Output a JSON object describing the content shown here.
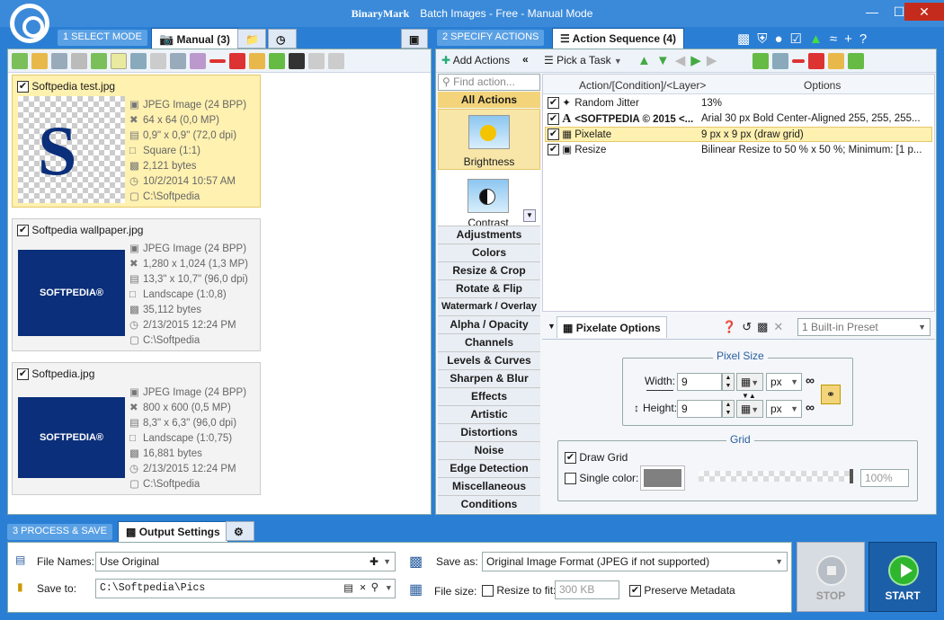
{
  "window": {
    "brand": "BinaryMark",
    "title": "Batch Images - Free - Manual Mode",
    "controls": [
      "—",
      "☐",
      "✕"
    ]
  },
  "modes": {
    "select_label": "1 SELECT MODE",
    "manual_tab": "Manual (3)",
    "specify_label": "2 SPECIFY ACTIONS",
    "sequence_tab": "Action Sequence (4)",
    "process_label": "3 PROCESS & SAVE",
    "output_tab": "Output Settings"
  },
  "images": [
    {
      "name": "Softpedia test.jpg",
      "type": "JPEG Image (24 BPP)",
      "dims": "64 x 64 (0,0 MP)",
      "print": "0,9\" x 0,9\" (72,0 dpi)",
      "aspect": "Square (1:1)",
      "size": "2,121 bytes",
      "date": "10/2/2014 10:57 AM",
      "path": "C:\\Softpedia",
      "thumb_text": ""
    },
    {
      "name": "Softpedia wallpaper.jpg",
      "type": "JPEG Image (24 BPP)",
      "dims": "1,280 x 1,024 (1,3 MP)",
      "print": "13,3\" x 10,7\" (96,0 dpi)",
      "aspect": "Landscape (1:0,8)",
      "size": "35,112 bytes",
      "date": "2/13/2015 12:24 PM",
      "path": "C:\\Softpedia",
      "thumb_text": "SOFTPEDIA®"
    },
    {
      "name": "Softpedia.jpg",
      "type": "JPEG Image (24 BPP)",
      "dims": "800 x 600 (0,5 MP)",
      "print": "8,3\" x 6,3\" (96,0 dpi)",
      "aspect": "Landscape (1:0,75)",
      "size": "16,881 bytes",
      "date": "2/13/2015 12:24 PM",
      "path": "C:\\Softpedia",
      "thumb_text": "SOFTPEDIA®"
    }
  ],
  "actions_toolbar": {
    "add_actions": "Add Actions",
    "pick_task": "Pick a Task",
    "collapse": "«"
  },
  "find_placeholder": "Find action...",
  "all_actions": "All Actions",
  "gallery": {
    "brightness": "Brightness",
    "contrast": "Contrast"
  },
  "categories": [
    "Adjustments",
    "Colors",
    "Resize & Crop",
    "Rotate & Flip",
    "Watermark / Overlay",
    "Alpha / Opacity",
    "Channels",
    "Levels & Curves",
    "Sharpen & Blur",
    "Effects",
    "Artistic",
    "Distortions",
    "Noise",
    "Edge Detection",
    "Miscellaneous",
    "Conditions"
  ],
  "sequence": {
    "col_action": "Action/[Condition]/<Layer>",
    "col_options": "Options",
    "rows": [
      {
        "name": "Random Jitter",
        "options": "13%"
      },
      {
        "name": "<SOFTPEDIA © 2015 <...",
        "options": "Arial 30 px Bold Center-Aligned 255, 255, 255..."
      },
      {
        "name": "Pixelate",
        "options": "9 px x 9 px (draw grid)"
      },
      {
        "name": "Resize",
        "options": "Bilinear Resize to 50 % x 50 %; Minimum: [1 p..."
      }
    ]
  },
  "options_panel": {
    "title": "Pixelate Options",
    "preset": "1 Built-in Preset",
    "pixel_size": "Pixel Size",
    "width_label": "Width:",
    "width": "9",
    "height_label": "Height:",
    "height": "9",
    "unit": "px",
    "grid": "Grid",
    "draw_grid": "Draw Grid",
    "single_color": "Single color:",
    "opacity": "100%"
  },
  "output": {
    "file_names_label": "File Names:",
    "file_names": "Use Original",
    "save_to_label": "Save to:",
    "save_to": "C:\\Softpedia\\Pics",
    "save_as_label": "Save as:",
    "save_as": "Original Image Format (JPEG if not supported)",
    "file_size_label": "File size:",
    "resize_to_fit": "Resize to fit:",
    "resize_value": "300 KB",
    "preserve_metadata": "Preserve Metadata"
  },
  "buttons": {
    "stop": "STOP",
    "start": "START"
  },
  "colors": {
    "accent": "#2a7fd4",
    "selected": "#fff1b0",
    "start": "#1b5fa8",
    "stop": "#d7dce2"
  }
}
